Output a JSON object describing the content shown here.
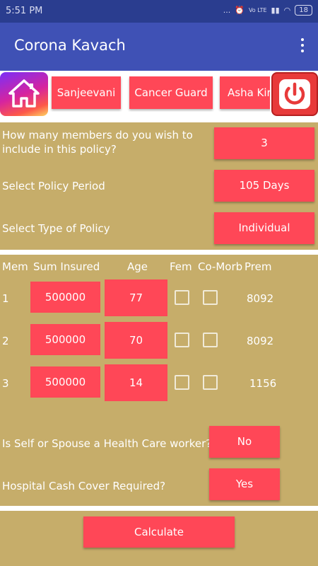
{
  "status": {
    "time": "5:51 PM",
    "signal": "... ",
    "volte": "Vo LTE",
    "battery": "18"
  },
  "app": {
    "title": "Corona Kavach"
  },
  "tabs": [
    "Sanjeevani",
    "Cancer Guard",
    "Asha Kiran"
  ],
  "form": {
    "members_question": "How many members do you wish to include in this policy?",
    "members_value": "3",
    "period_label": "Select Policy Period",
    "period_value": "105 Days",
    "type_label": "Select Type of Policy",
    "type_value": "Individual"
  },
  "table": {
    "headers": {
      "mem": "Mem",
      "sum": "Sum Insured",
      "age": "Age",
      "fem": "Fem",
      "comorb": "Co-Morb",
      "prem": "Prem"
    },
    "rows": [
      {
        "mem": "1",
        "sum": "500000",
        "age": "77",
        "fem": false,
        "comorb": false,
        "prem": "8092"
      },
      {
        "mem": "2",
        "sum": "500000",
        "age": "70",
        "fem": false,
        "comorb": false,
        "prem": "8092"
      },
      {
        "mem": "3",
        "sum": "500000",
        "age": "14",
        "fem": false,
        "comorb": false,
        "prem": "1156"
      }
    ]
  },
  "extra": {
    "hcw_label": "Is Self or Spouse a Health Care worker?",
    "hcw_value": "No",
    "cash_label": "Hospital Cash Cover Required?",
    "cash_value": "Yes"
  },
  "calculate_label": "Calculate"
}
